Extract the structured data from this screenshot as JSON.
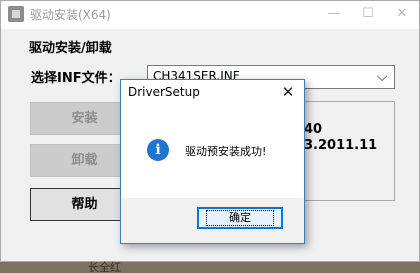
{
  "window": {
    "title": "驱动安装(X64)",
    "minimize_glyph": "—",
    "maximize_glyph": "☐",
    "close_glyph": "✕"
  },
  "group": {
    "title": "驱动安装/卸载"
  },
  "inf": {
    "label": "选择INF文件：",
    "selected": "CH341SER.INF",
    "arrow": "⌵"
  },
  "buttons": {
    "install": "安装",
    "uninstall": "卸载",
    "help": "帮助"
  },
  "info": {
    "line1": "40",
    "line2": "3.2011.11"
  },
  "dialog": {
    "title": "DriverSetup",
    "close_glyph": "✕",
    "icon_glyph": "i",
    "message": "驱动预安装成功!",
    "ok_label": "确定"
  },
  "background": {
    "partial_text": "长全红"
  },
  "colors": {
    "accent": "#0078d7",
    "info_icon": "#1e76cf"
  }
}
